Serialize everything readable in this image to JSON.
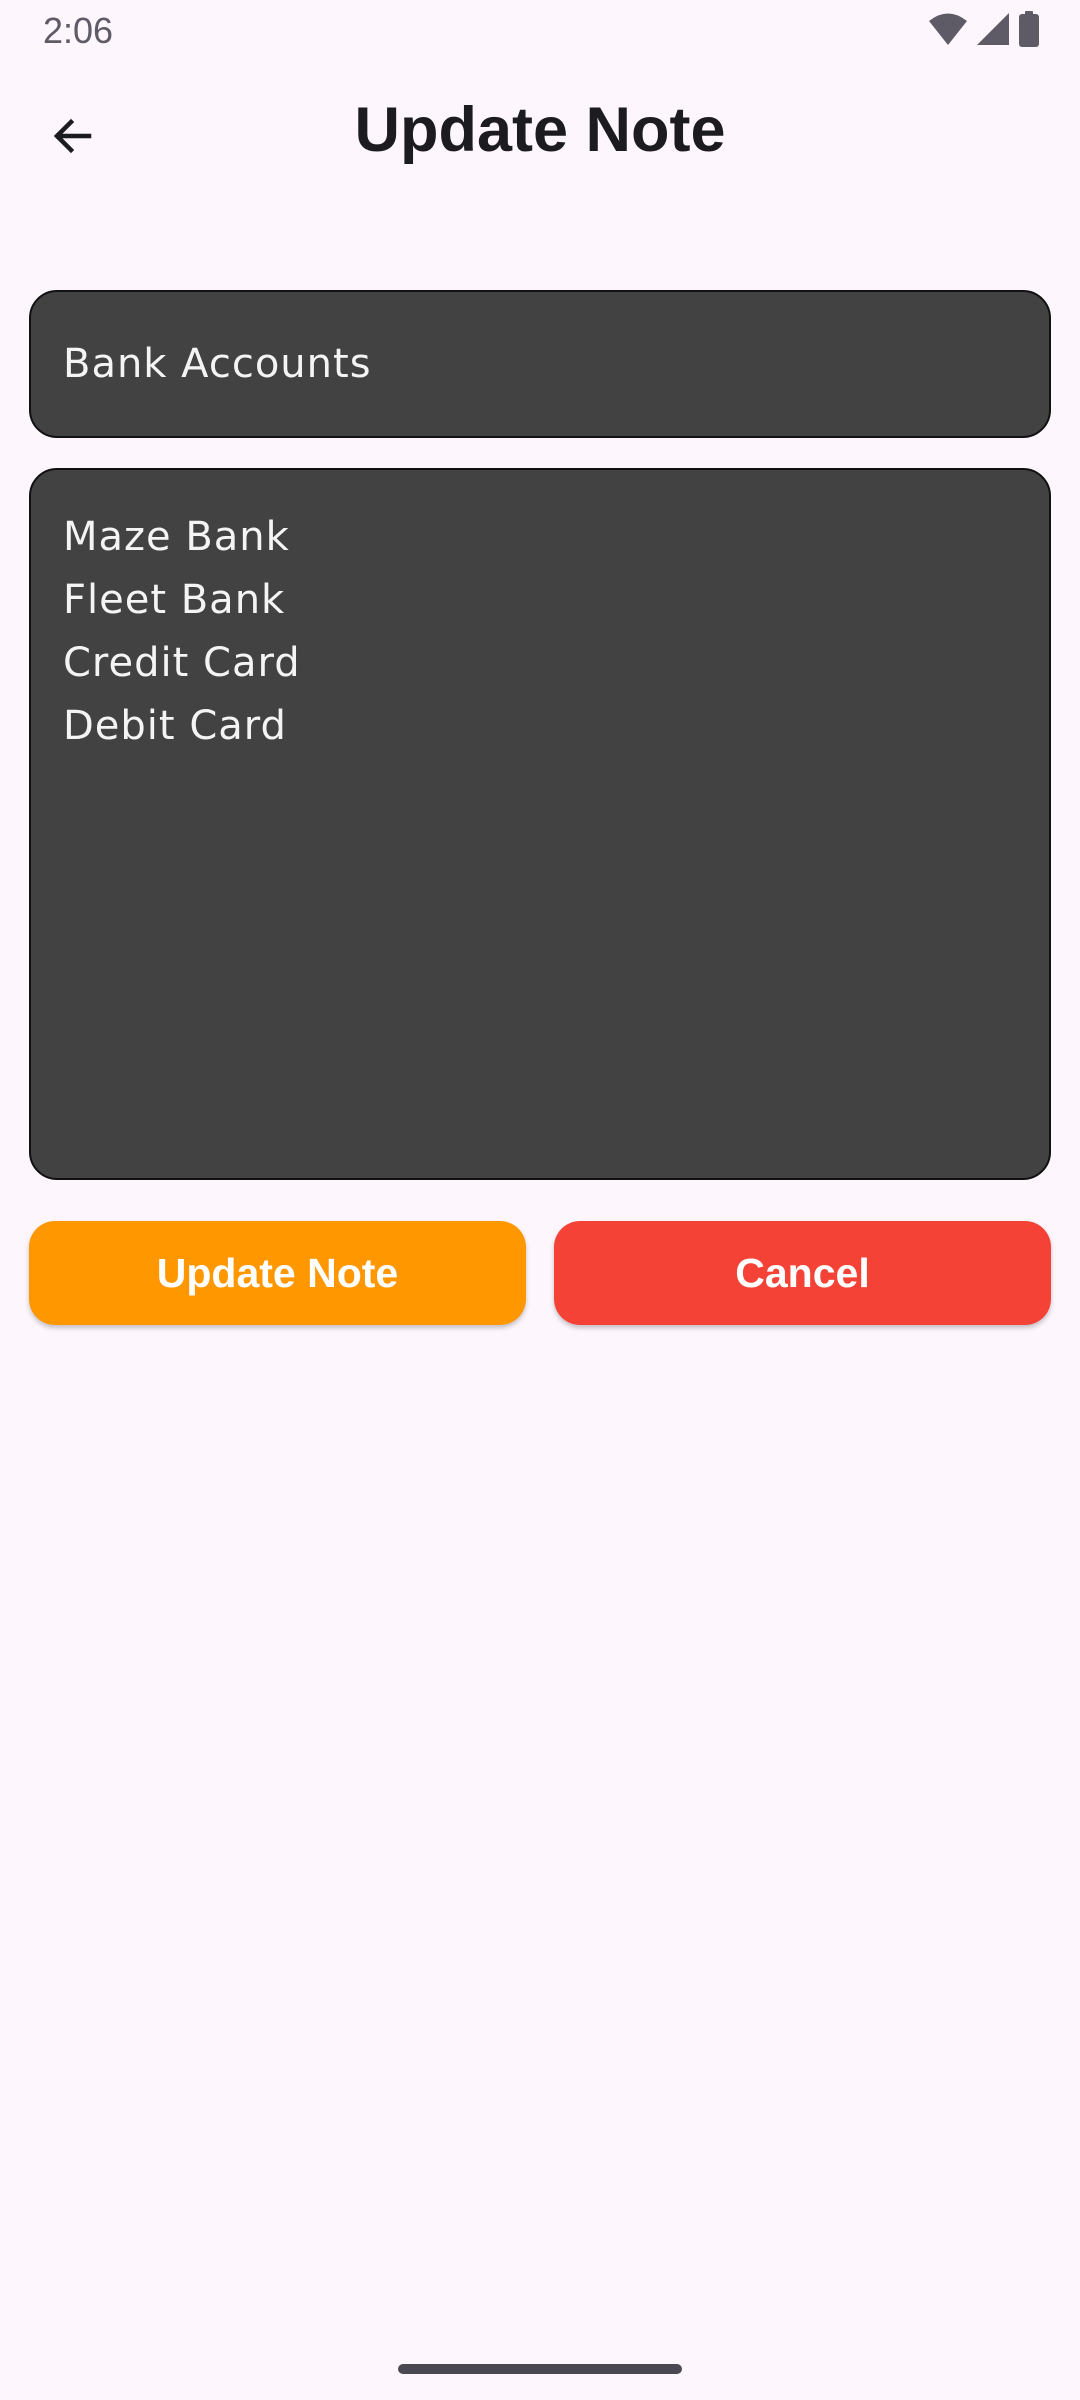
{
  "status_bar": {
    "time": "2:06",
    "icons": [
      "wifi-icon",
      "cellular-signal-icon",
      "battery-icon"
    ],
    "icon_color": "#5f5b66"
  },
  "app_bar": {
    "back_icon": "arrow-left-icon",
    "title": "Update Note"
  },
  "note": {
    "title_value": "Bank Accounts",
    "body_lines": [
      "Maze Bank",
      "Fleet Bank",
      "Credit Card",
      "Debit Card"
    ]
  },
  "actions": {
    "update_label": "Update Note",
    "cancel_label": "Cancel"
  },
  "colors": {
    "background": "#fdf6fd",
    "field_background": "#424242",
    "update_button": "#ff9800",
    "cancel_button": "#f44336"
  }
}
